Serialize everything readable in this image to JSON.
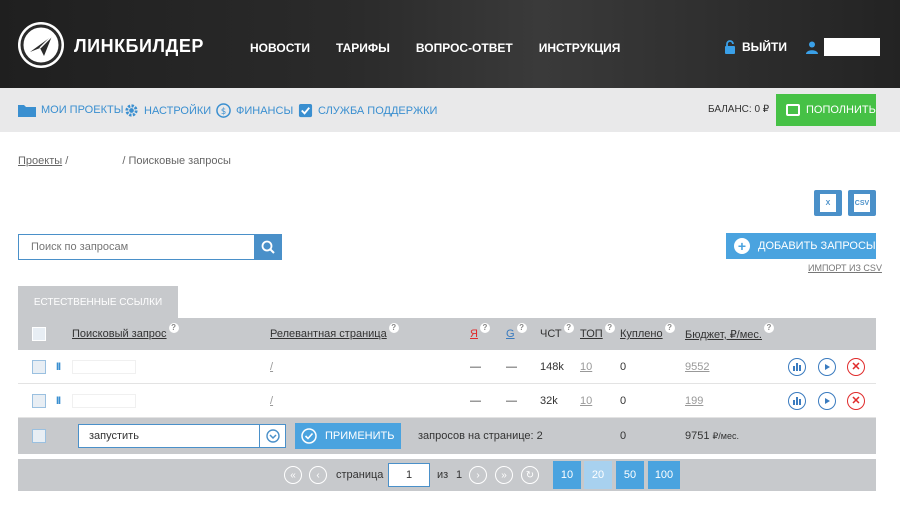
{
  "header": {
    "logo_text": "ЛИНКБИЛДЕР",
    "nav": [
      "НОВОСТИ",
      "ТАРИФЫ",
      "ВОПРОС-ОТВЕТ",
      "ИНСТРУКЦИЯ"
    ],
    "exit_label": "ВЫЙТИ"
  },
  "subnav": {
    "items": [
      "МОИ ПРОЕКТЫ",
      "НАСТРОЙКИ",
      "ФИНАНСЫ",
      "СЛУЖБА ПОДДЕРЖКИ"
    ],
    "balance": "БАЛАНС: 0 ₽",
    "topup_label": "ПОПОЛНИТЬ"
  },
  "breadcrumb": {
    "root": "Проекты",
    "sep1": "/",
    "current": "/ Поисковые запросы"
  },
  "files": {
    "excel": "X",
    "csv": "CSV"
  },
  "search": {
    "placeholder": "Поиск по запросам"
  },
  "add_button": "ДОБАВИТЬ ЗАПРОСЫ",
  "import_link": "ИМПОРТ ИЗ CSV",
  "tab": "ЕСТЕСТВЕННЫЕ ССЫЛКИ",
  "table": {
    "headers": {
      "query": "Поисковый запрос",
      "page": "Релевантная страница",
      "y": "Я",
      "g": "G",
      "chst": "ЧСТ",
      "top": "ТОП",
      "bought": "Куплено",
      "budget": "Бюджет, ₽/мес."
    },
    "rows": [
      {
        "pause": "II",
        "page": "/",
        "y": "—",
        "g": "—",
        "chst": "148k",
        "top": "10",
        "bought": "0",
        "budget": "9552"
      },
      {
        "pause": "II",
        "page": "/",
        "y": "—",
        "g": "—",
        "chst": "32k",
        "top": "10",
        "bought": "0",
        "budget": "199"
      }
    ],
    "footer": {
      "action_value": "запустить",
      "apply_label": "ПРИМЕНИТЬ",
      "per_page": "запросов на странице: 2",
      "bought_total": "0",
      "budget_total": "9751",
      "budget_unit": "₽/мес."
    }
  },
  "pager": {
    "page_label": "страница",
    "page_value": "1",
    "of_label": "из",
    "total_pages": "1",
    "sizes": [
      "10",
      "20",
      "50",
      "100"
    ],
    "active_size": "20"
  },
  "colors": {
    "accent": "#4aa3df",
    "green": "#46c146",
    "danger": "#e02b2b"
  }
}
